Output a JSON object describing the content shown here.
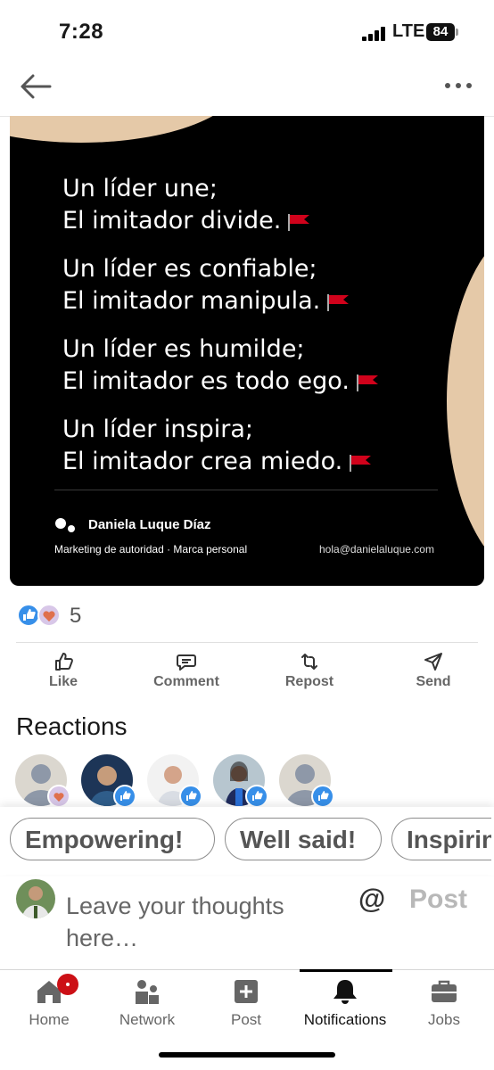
{
  "status_bar": {
    "time": "7:28",
    "network": "LTE",
    "battery": "84"
  },
  "post_image": {
    "quote_lines": [
      "Un líder une;",
      "El imitador divide.",
      "Un líder es confiable;",
      "El imitador manipula.",
      "Un líder es humilde;",
      "El imitador es todo ego.",
      "Un líder inspira;",
      "El imitador crea miedo."
    ],
    "brand_name": "Daniela Luque Díaz",
    "brand_tagline": "Marketing de autoridad · Marca personal",
    "brand_email": "hola@danielaluque.com",
    "colors": {
      "background": "#000000",
      "accent_shape": "#e5c9a8",
      "flag": "#d0021b"
    }
  },
  "reactions_summary": {
    "count": "5",
    "icons": [
      "like-reaction-icon",
      "love-reaction-icon"
    ]
  },
  "actions": [
    {
      "label": "Like",
      "icon": "like-icon"
    },
    {
      "label": "Comment",
      "icon": "comment-icon"
    },
    {
      "label": "Repost",
      "icon": "repost-icon"
    },
    {
      "label": "Send",
      "icon": "send-icon"
    }
  ],
  "reactions_section": {
    "title": "Reactions"
  },
  "suggestions": [
    "Empowering!",
    "Well said!",
    "Inspiring!"
  ],
  "composer": {
    "placeholder": "Leave your thoughts here…",
    "mention_symbol": "@",
    "post_label": "Post"
  },
  "bottom_nav": [
    {
      "label": "Home",
      "icon": "home-icon"
    },
    {
      "label": "Network",
      "icon": "network-icon"
    },
    {
      "label": "Post",
      "icon": "plus-icon"
    },
    {
      "label": "Notifications",
      "icon": "bell-icon",
      "active": true
    },
    {
      "label": "Jobs",
      "icon": "briefcase-icon"
    }
  ],
  "colors": {
    "linkedin_blue": "#0a66c2",
    "notification_red": "#cc1016"
  }
}
